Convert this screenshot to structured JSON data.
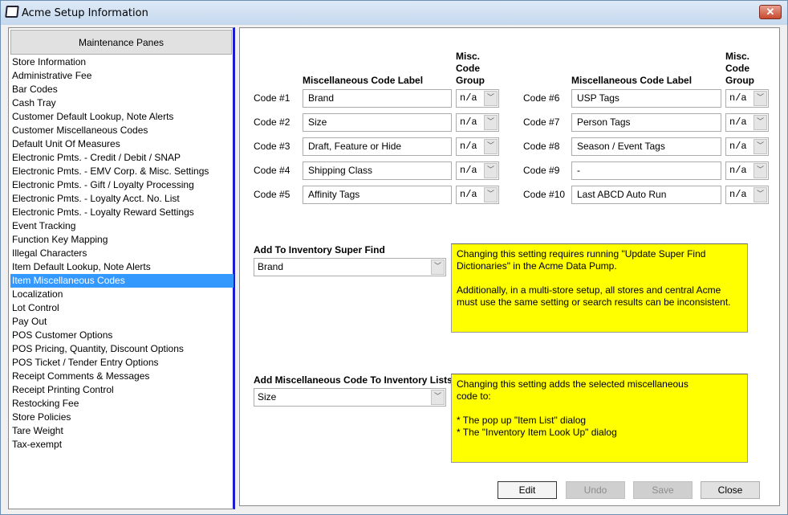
{
  "window": {
    "title": "Acme Setup Information",
    "close": "✕"
  },
  "sidebar": {
    "header": "Maintenance Panes",
    "selected_index": 20,
    "items": [
      "Store Information",
      "Administrative Fee",
      "Bar Codes",
      "Cash Tray",
      "Customer Default Lookup, Note Alerts",
      "Customer Miscellaneous Codes",
      "Default Unit Of Measures",
      "Electronic Pmts. - Credit / Debit / SNAP",
      "Electronic Pmts. - EMV Corp. & Misc. Settings",
      "Electronic Pmts. - Gift / Loyalty Processing",
      "Electronic Pmts. - Loyalty Acct. No. List",
      "Electronic Pmts. - Loyalty Reward Settings",
      "Event Tracking",
      "Function Key Mapping",
      "Illegal Characters",
      "Item Default Lookup, Note Alerts",
      "Item Miscellaneous Codes",
      "Localization",
      "Lot Control",
      "Pay Out",
      "POS Customer Options",
      "POS Pricing, Quantity, Discount Options",
      "POS Ticket / Tender Entry Options",
      "Receipt Comments & Messages",
      "Receipt Printing Control",
      "Restocking Fee",
      "Store Policies",
      "Tare  Weight",
      "Tax-exempt"
    ]
  },
  "codes": {
    "label_header": "Miscellaneous Code Label",
    "group_header": [
      "Misc.",
      "Code",
      "Group"
    ],
    "rows": [
      {
        "code": "Code #1",
        "label": "Brand",
        "group": "n/a"
      },
      {
        "code": "Code #2",
        "label": "Size",
        "group": "n/a"
      },
      {
        "code": "Code #3",
        "label": "Draft, Feature or Hide",
        "group": "n/a"
      },
      {
        "code": "Code #4",
        "label": "Shipping Class",
        "group": "n/a"
      },
      {
        "code": "Code #5",
        "label": "Affinity Tags",
        "group": "n/a"
      },
      {
        "code": "Code #6",
        "label": "USP Tags",
        "group": "n/a"
      },
      {
        "code": "Code #7",
        "label": "Person Tags",
        "group": "n/a"
      },
      {
        "code": "Code #8",
        "label": "Season / Event Tags",
        "group": "n/a"
      },
      {
        "code": "Code #9",
        "label": "-",
        "group": "n/a"
      },
      {
        "code": "Code #10",
        "label": "Last ABCD Auto Run",
        "group": "n/a"
      }
    ]
  },
  "super_find": {
    "label": "Add To Inventory Super Find",
    "value": "Brand",
    "note": "Changing this setting requires running \"Update Super Find Dictionaries\" in the Acme Data Pump.\n\nAdditionally, in a multi-store setup, all stores and central Acme must use the same setting or search results can be inconsistent."
  },
  "inventory_lists": {
    "label": "Add Miscellaneous Code To Inventory Lists",
    "value": "Size",
    "note": "Changing this setting adds the selected miscellaneous\ncode to:\n\n* The pop up \"Item List\" dialog\n* The \"Inventory Item Look Up\" dialog"
  },
  "buttons": {
    "edit": "Edit",
    "undo": "Undo",
    "save": "Save",
    "close": "Close"
  }
}
